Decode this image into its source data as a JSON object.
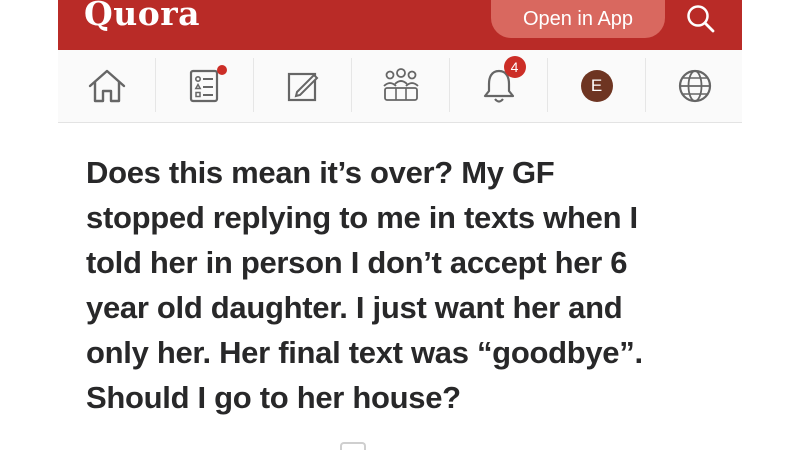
{
  "header": {
    "logo": "Quora",
    "open_app_label": "Open in App",
    "search_icon": "search-icon"
  },
  "nav": {
    "items": [
      {
        "icon": "home-icon"
      },
      {
        "icon": "answer-list-icon",
        "has_dot": true
      },
      {
        "icon": "edit-icon"
      },
      {
        "icon": "spaces-icon"
      },
      {
        "icon": "bell-icon",
        "badge": "4"
      },
      {
        "icon": "avatar",
        "initial": "E"
      },
      {
        "icon": "globe-icon"
      }
    ]
  },
  "question": {
    "lines": [
      "Does this mean it’s over? My GF",
      "stopped replying to me in texts when I",
      "told her in person I don’t accept her 6",
      "year old daughter. I just want her and",
      "only her. Her final text was “goodbye”.",
      "Should I go to her house?"
    ]
  },
  "colors": {
    "brand": "#b92b27",
    "button": "#d9685f",
    "badge": "#cc2e27",
    "avatar": "#6e3522",
    "text": "#282829"
  }
}
